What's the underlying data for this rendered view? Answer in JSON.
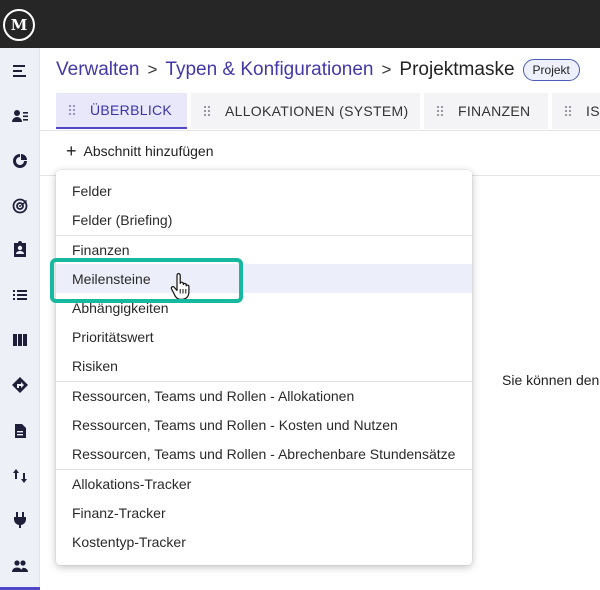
{
  "app": {
    "logo_text": "M",
    "brand_color": "#4338a8",
    "topbar_color": "#262626",
    "highlight_color": "#17b8a0"
  },
  "sidebar": {
    "items": [
      {
        "icon": "menu-collapse-icon"
      },
      {
        "icon": "user-list-icon"
      },
      {
        "icon": "pie-chart-icon"
      },
      {
        "icon": "target-icon"
      },
      {
        "icon": "clipboard-user-icon"
      },
      {
        "icon": "list-icon"
      },
      {
        "icon": "board-columns-icon"
      },
      {
        "icon": "route-diamond-icon"
      },
      {
        "icon": "document-icon"
      },
      {
        "icon": "sort-arrows-icon"
      },
      {
        "icon": "plug-icon"
      },
      {
        "icon": "people-icon"
      }
    ]
  },
  "breadcrumb": {
    "items": [
      "Verwalten",
      "Typen & Konfigurationen"
    ],
    "current": "Projektmaske",
    "separator": ">",
    "badge": "Projekt"
  },
  "tabs": [
    {
      "label": "ÜBERBLICK",
      "active": true
    },
    {
      "label": "ALLOKATIONEN (SYSTEM)",
      "active": false
    },
    {
      "label": "FINANZEN",
      "active": false
    },
    {
      "label": "IS",
      "active": false
    }
  ],
  "add_section": {
    "plus": "+",
    "label": "Abschnitt hinzufügen"
  },
  "hint_text": "Sie können den",
  "menu": {
    "groups": [
      [
        "Felder",
        "Felder (Briefing)"
      ],
      [
        "Finanzen",
        "Meilensteine",
        "Abhängigkeiten",
        "Prioritätswert",
        "Risiken"
      ],
      [
        "Ressourcen, Teams und Rollen - Allokationen",
        "Ressourcen, Teams und Rollen - Kosten und Nutzen",
        "Ressourcen, Teams und Rollen - Abrechenbare Stundensätze"
      ],
      [
        "Allokations-Tracker",
        "Finanz-Tracker",
        "Kostentyp-Tracker"
      ]
    ],
    "hovered_item": "Meilensteine"
  }
}
